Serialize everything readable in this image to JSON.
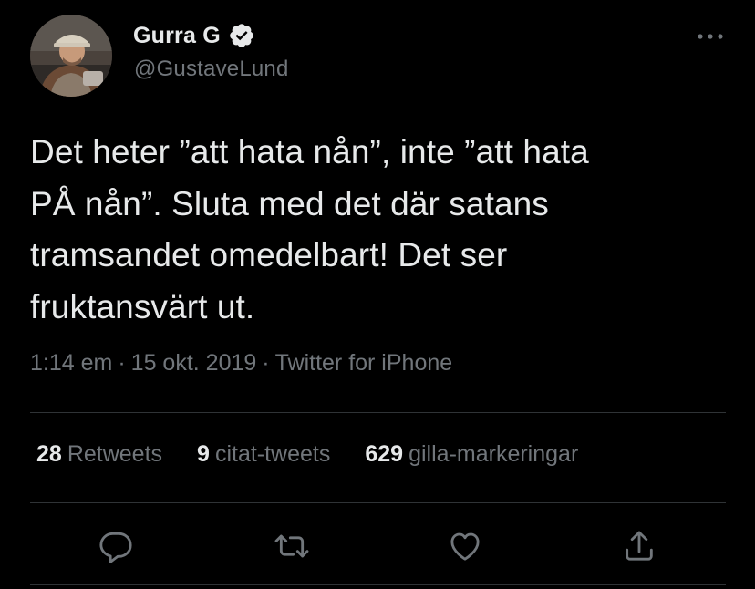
{
  "author": {
    "display_name": "Gurra G",
    "handle": "@GustaveLund",
    "verified": true,
    "avatar_icon": "user-avatar"
  },
  "tweet": {
    "text": "Det heter ”att hata nån”, inte ”att hata\nPÅ nån”. Sluta med det där satans\ntramsandet omedelbart! Det ser\nfruktansvärt ut.",
    "time": "1:14 em",
    "date": "15 okt. 2019",
    "separator": "·",
    "source": "Twitter for iPhone"
  },
  "stats": {
    "retweets_count": "28",
    "retweets_label": "Retweets",
    "quotes_count": "9",
    "quotes_label": "citat-tweets",
    "likes_count": "629",
    "likes_label": "gilla-markeringar"
  },
  "actions": [
    {
      "name": "reply",
      "icon": "reply-icon"
    },
    {
      "name": "retweet",
      "icon": "retweet-icon"
    },
    {
      "name": "like",
      "icon": "heart-icon"
    },
    {
      "name": "share",
      "icon": "share-icon"
    }
  ],
  "colors": {
    "background": "#000000",
    "text_primary": "#e7e9ea",
    "text_secondary": "#71767b",
    "divider": "#2f3336"
  }
}
